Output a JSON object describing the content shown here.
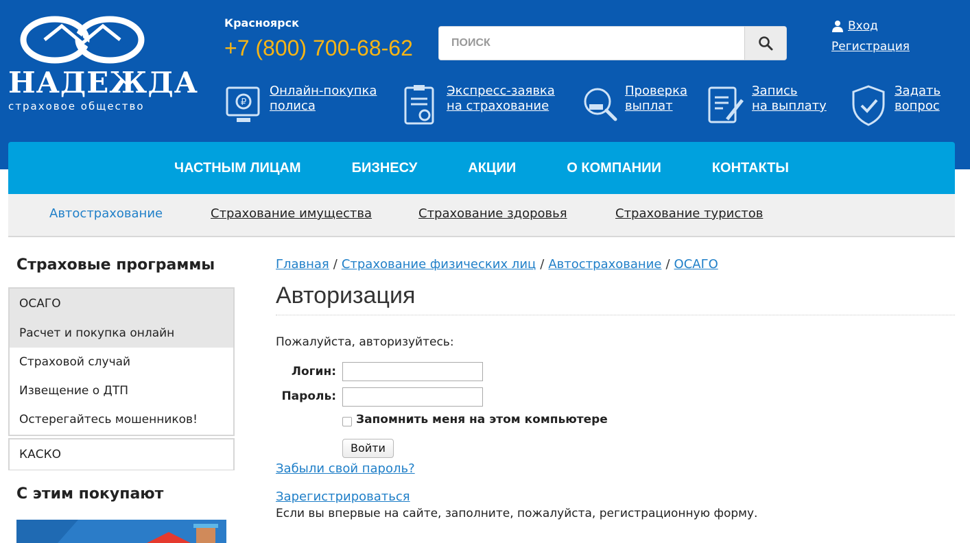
{
  "brand": {
    "name": "НАДЕЖДА",
    "tagline": "страховое общество"
  },
  "header": {
    "city": "Красноярск",
    "phone": "+7 (800) 700-68-62",
    "search_placeholder": "ПОИСК",
    "login_label": "Вход",
    "register_label": "Регистрация",
    "accent_color": "#f7b515",
    "header_color": "#0a5ab1"
  },
  "quick_links": [
    {
      "icon": "online-purchase-icon",
      "line1": "Онлайн-покупка",
      "line2": "полиса"
    },
    {
      "icon": "express-application-icon",
      "line1": "Экспресс-заявка",
      "line2": "на страхование"
    },
    {
      "icon": "payment-check-icon",
      "line1": "Проверка",
      "line2": "выплат"
    },
    {
      "icon": "payout-signup-icon",
      "line1": "Запись",
      "line2": "на выплату"
    },
    {
      "icon": "shield-question-icon",
      "line1": "Задать",
      "line2": "вопрос"
    }
  ],
  "main_nav": [
    "ЧАСТНЫМ ЛИЦАМ",
    "БИЗНЕСУ",
    "АКЦИИ",
    "О КОМПАНИИ",
    "КОНТАКТЫ"
  ],
  "sub_nav": [
    "Автострахование",
    "Страхование имущества",
    "Страхование здоровья",
    "Страхование туристов"
  ],
  "sidebar": {
    "title": "Страховые программы",
    "groups": [
      {
        "label": "ОСАГО",
        "items": [
          "Расчет и покупка онлайн",
          "Страховой случай",
          "Извещение о ДТП",
          "Остерегайтесь мошенников!"
        ],
        "active_item": 0
      },
      {
        "label": "КАСКО",
        "items": []
      }
    ],
    "title2": "С этим покупают"
  },
  "breadcrumb": [
    "Главная",
    "Страхование физических лиц",
    "Автострахование",
    "ОСАГО"
  ],
  "auth": {
    "title": "Авторизация",
    "intro": "Пожалуйста, авторизуйтесь:",
    "login_label": "Логин:",
    "password_label": "Пароль:",
    "login_value": "",
    "password_value": "",
    "remember_label": "Запомнить меня на этом компьютере",
    "remember_checked": false,
    "submit_label": "Войти",
    "forgot_label": "Забыли свой пароль?",
    "register_label": "Зарегистрироваться",
    "register_note": "Если вы впервые на сайте, заполните, пожалуйста, регистрационную форму."
  }
}
